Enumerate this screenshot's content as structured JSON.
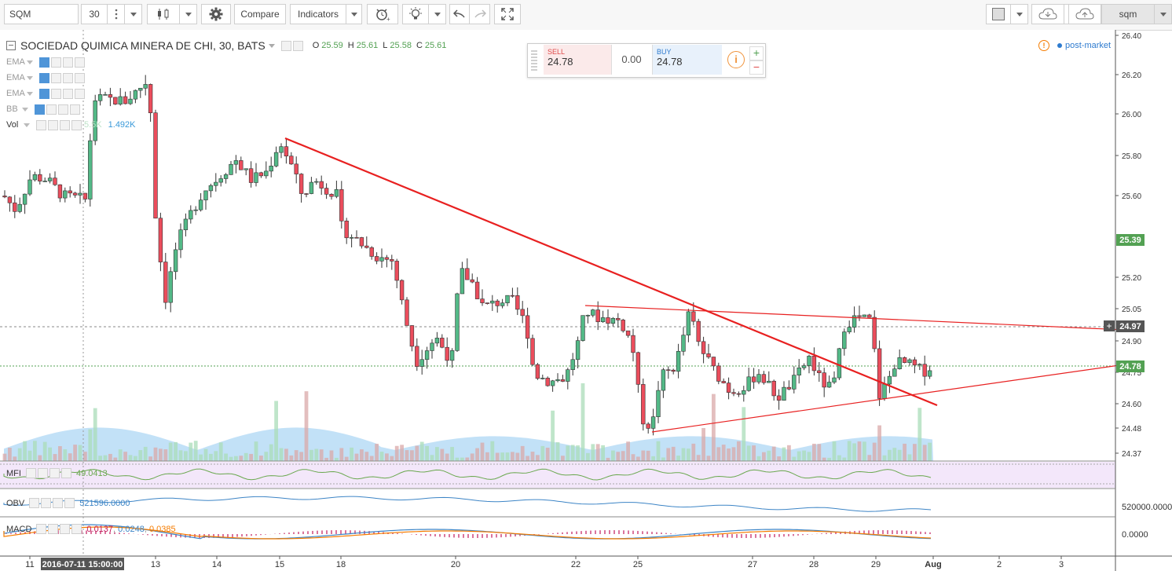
{
  "toolbar": {
    "symbol": "SQM",
    "interval": "30",
    "compare_label": "Compare",
    "indicators_label": "Indicators",
    "search_value": "sqm"
  },
  "legend": {
    "title": "SOCIEDAD QUIMICA MINERA DE CHI, 30, BATS",
    "o_label": "O",
    "o_value": "25.59",
    "h_label": "H",
    "h_value": "25.61",
    "l_label": "L",
    "l_value": "25.58",
    "c_label": "C",
    "c_value": "25.61",
    "indicators": [
      {
        "name": "EMA",
        "value": ""
      },
      {
        "name": "EMA",
        "value": ""
      },
      {
        "name": "EMA",
        "value": ""
      },
      {
        "name": "BB",
        "value": ""
      },
      {
        "name": "Vol",
        "value": "1.492K",
        "faded": "5.5K"
      }
    ],
    "status": "post-market"
  },
  "trade": {
    "sell_label": "SELL",
    "sell_price": "24.78",
    "spread": "0.00",
    "buy_label": "BUY",
    "buy_price": "24.78"
  },
  "price_axis": {
    "ticks": [
      "26.40",
      "26.20",
      "26.00",
      "25.80",
      "25.60",
      "25.39",
      "25.20",
      "25.05",
      "24.97",
      "24.90",
      "24.78",
      "24.75",
      "24.60",
      "24.48",
      "24.37"
    ],
    "tags": {
      "high": "25.39",
      "line": "24.97",
      "last": "24.78"
    }
  },
  "panes": {
    "mfi": {
      "name": "MFI",
      "value": "49.0413"
    },
    "obv": {
      "name": "OBV",
      "value": "521596.0000",
      "axis": "520000.0000"
    },
    "macd": {
      "name": "MACD",
      "v1": "0.0137",
      "v2": "0.0248",
      "v3": "0.0385",
      "axis": "0.0000"
    }
  },
  "time_axis": {
    "labels": [
      "11",
      "2016-07-11 15:00:00",
      "13",
      "14",
      "15",
      "18",
      "20",
      "22",
      "25",
      "27",
      "28",
      "29",
      "Aug",
      "2",
      "3"
    ]
  },
  "colors": {
    "up": "#53b987",
    "down": "#eb4d5c",
    "trend": "#e82020",
    "volume_fill": "#8fc8f0",
    "tag_green": "#53a153"
  }
}
